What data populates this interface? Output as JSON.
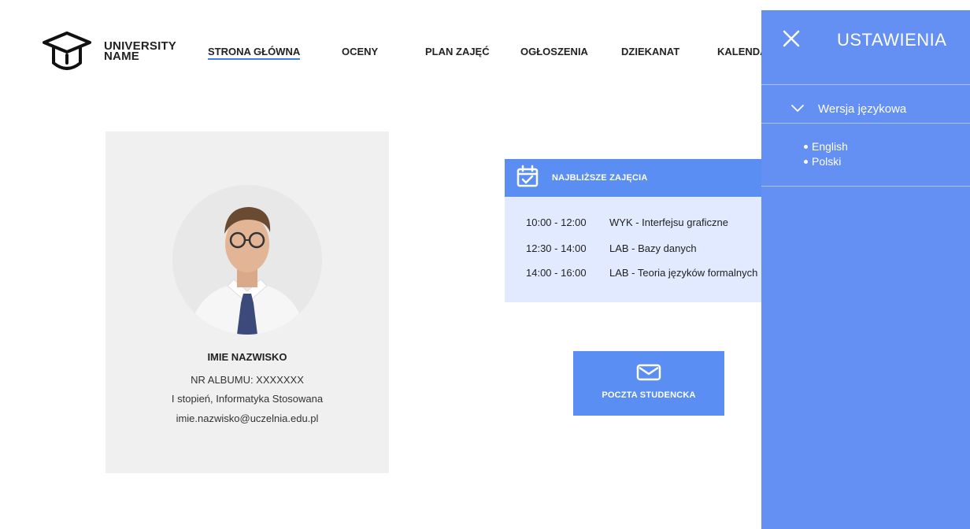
{
  "brand": {
    "line1": "UNIVERSITY",
    "line2": "NAME",
    "icon": "graduation-cap-icon"
  },
  "nav": {
    "items": [
      {
        "label": "STRONA GŁÓWNA",
        "active": true
      },
      {
        "label": "OCENY"
      },
      {
        "label": "PLAN ZAJĘĆ"
      },
      {
        "label": "OGŁOSZENIA"
      },
      {
        "label": "DZIEKANAT"
      },
      {
        "label": "KALENDARZ"
      }
    ]
  },
  "profile": {
    "name": "IMIE NAZWISKO",
    "album": "NR ALBUMU: XXXXXXX",
    "program": "I stopień, Informatyka Stosowana",
    "email": "imie.nazwisko@uczelnia.edu.pl"
  },
  "classes": {
    "title": "NAJBLIŻSZE ZAJĘCIA",
    "icon": "calendar-check-icon",
    "rows": [
      {
        "time": "10:00 - 12:00",
        "name": "WYK - Interfejsu graficzne"
      },
      {
        "time": "12:30 - 14:00",
        "name": "LAB - Bazy danych"
      },
      {
        "time": "14:00 - 16:00",
        "name": "LAB - Teoria języków formalnych"
      }
    ]
  },
  "mail": {
    "label": "POCZTA STUDENCKA",
    "icon": "envelope-icon"
  },
  "settings": {
    "title": "USTAWIENIA",
    "close_icon": "close-icon",
    "language_section": "Wersja językowa",
    "languages": [
      "English",
      "Polski"
    ]
  },
  "colors": {
    "accent": "#5b8ef2",
    "panel": "#6490f4",
    "card": "#f0f0f0",
    "classes_bg": "#e1eafe",
    "underline": "#3f7de6"
  }
}
